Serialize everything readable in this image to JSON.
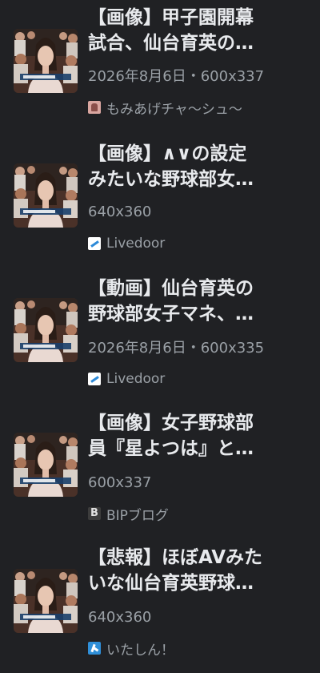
{
  "results": [
    {
      "title_line1": "【画像】甲子園開幕",
      "title_line2": "試合、仙台育英の…",
      "meta": "2026年8月6日・600x337",
      "source": "もみあげチャ〜シュ〜",
      "favicon": "momiage-favicon"
    },
    {
      "title_line1": "【画像】∧∨の設定",
      "title_line2": "みたいな野球部女…",
      "meta": "640x360",
      "source": "Livedoor",
      "favicon": "livedoor-favicon"
    },
    {
      "title_line1": "【動画】仙台育英の",
      "title_line2": "野球部女子マネ、…",
      "meta": "2026年8月6日・600x335",
      "source": "Livedoor",
      "favicon": "livedoor-favicon"
    },
    {
      "title_line1": "【画像】女子野球部",
      "title_line2": "員『星よつは』と…",
      "meta": "600x337",
      "source": "BIPブログ",
      "favicon": "bip-favicon",
      "favicon_letter": "B"
    },
    {
      "title_line1": "【悲報】ほぼAVみた",
      "title_line2": "いな仙台育英野球…",
      "meta": "640x360",
      "source": "いたしん！",
      "favicon": "itashin-favicon"
    }
  ]
}
